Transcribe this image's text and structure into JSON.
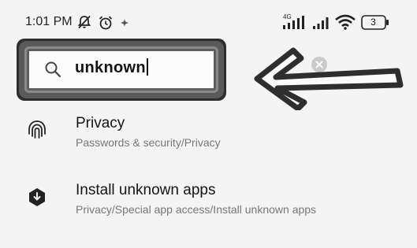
{
  "status_bar": {
    "time": "1:01 PM",
    "network_label": "4G",
    "battery_level": "3",
    "icons": [
      "mute-icon",
      "alarm-icon",
      "notification-icon",
      "signal-4g-icon",
      "signal-icon",
      "wifi-icon",
      "battery-icon"
    ]
  },
  "search": {
    "value": "unknown",
    "icon": "search-icon",
    "clear_icon": "clear-icon"
  },
  "annotation": {
    "icon": "arrow-left-icon"
  },
  "results": [
    {
      "title": "Privacy",
      "path": "Passwords & security/Privacy",
      "icon": "fingerprint-icon"
    },
    {
      "title": "Install unknown apps",
      "path": "Privacy/Special app access/Install unknown apps",
      "icon": "install-apps-icon"
    }
  ],
  "colors": {
    "background": "#f4f4f4",
    "text_primary": "#141414",
    "text_secondary": "#777777",
    "annotation": "#2e2e2e"
  }
}
